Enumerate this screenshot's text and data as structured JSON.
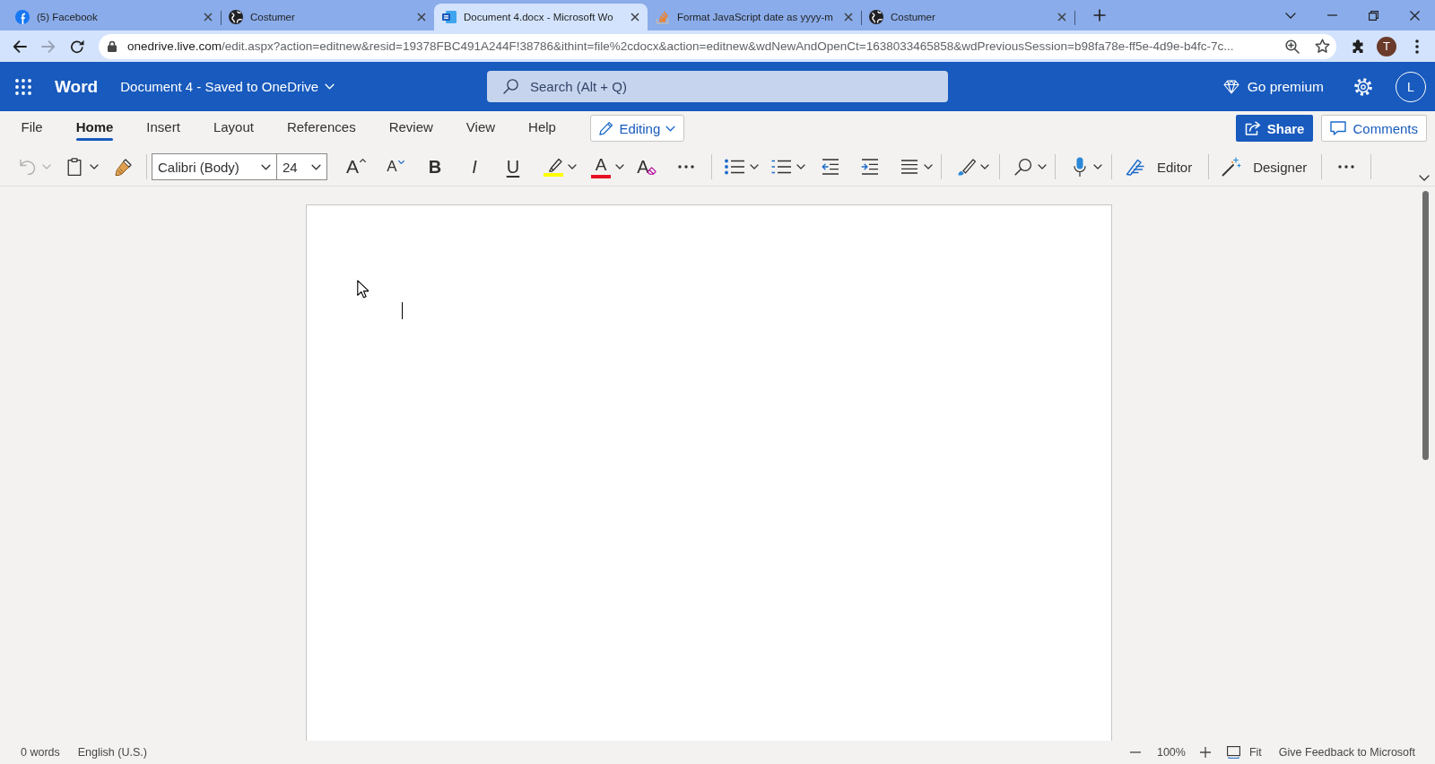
{
  "browser": {
    "tabs": [
      {
        "title": "(5) Facebook",
        "selected": false
      },
      {
        "title": "Costumer",
        "selected": false
      },
      {
        "title": "Document 4.docx - Microsoft Wo",
        "selected": true
      },
      {
        "title": "Format JavaScript date as yyyy-m",
        "selected": false
      },
      {
        "title": "Costumer",
        "selected": false
      }
    ],
    "back": {
      "disabled": false
    },
    "forward": {
      "disabled": true
    },
    "address": {
      "host": "onedrive.live.com",
      "path": "/edit.aspx?action=editnew&resid=19378FBC491A244F!38786&ithint=file%2cdocx&action=editnew&wdNewAndOpenCt=1638033465858&wdPreviousSession=b98fa78e-ff5e-4d9e-b4fc-7c..."
    },
    "profile": "T"
  },
  "app_bar": {
    "app_name": "Word",
    "document_title": "Document 4 - Saved to OneDrive",
    "search": {
      "placeholder": "Search (Alt + Q)"
    },
    "premium": "Go premium",
    "account": "L"
  },
  "ribbon": {
    "tabs": [
      {
        "label": "File",
        "selected": false
      },
      {
        "label": "Home",
        "selected": true
      },
      {
        "label": "Insert",
        "selected": false
      },
      {
        "label": "Layout",
        "selected": false
      },
      {
        "label": "References",
        "selected": false
      },
      {
        "label": "Review",
        "selected": false
      },
      {
        "label": "View",
        "selected": false
      },
      {
        "label": "Help",
        "selected": false
      }
    ],
    "mode": "Editing",
    "share": "Share",
    "comments": "Comments"
  },
  "toolbar": {
    "undo": {
      "disabled": true
    },
    "font": "Calibri (Body)",
    "font_size": "24",
    "grow_font": "A",
    "shrink_font": "A",
    "bold": "B",
    "italic": "I",
    "underline": "U",
    "font_color": "A",
    "clear_formatting": "A",
    "editor": "Editor",
    "designer": "Designer"
  },
  "status_bar": {
    "word_count": "0 words",
    "language": "English (U.S.)",
    "zoom": "100%",
    "fit": "Fit",
    "feedback": "Give Feedback to Microsoft"
  }
}
